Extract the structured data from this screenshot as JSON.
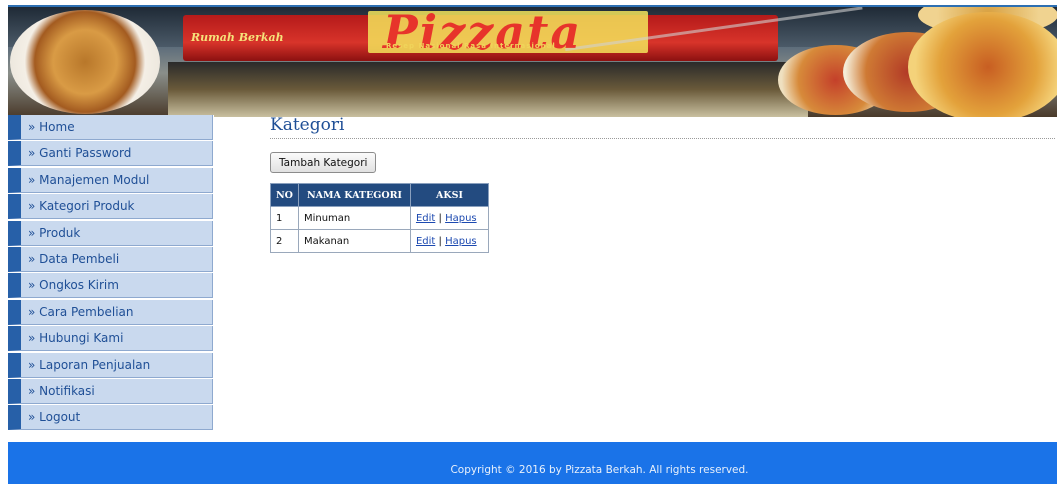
{
  "banner": {
    "tagline_rumah": "Rumah Berkah",
    "brand_name": "Pizzata",
    "brand_subtitle": "Resep Nasional Rasa Internasional"
  },
  "sidebar": {
    "items": [
      {
        "label": "» Home"
      },
      {
        "label": "» Ganti Password"
      },
      {
        "label": "» Manajemen Modul"
      },
      {
        "label": "» Kategori Produk"
      },
      {
        "label": "» Produk"
      },
      {
        "label": "» Data Pembeli"
      },
      {
        "label": "» Ongkos Kirim"
      },
      {
        "label": "» Cara Pembelian"
      },
      {
        "label": "» Hubungi Kami"
      },
      {
        "label": "» Laporan Penjualan"
      },
      {
        "label": "» Notifikasi"
      },
      {
        "label": "» Logout"
      }
    ]
  },
  "main": {
    "title": "Kategori",
    "add_button_label": "Tambah Kategori",
    "table": {
      "headers": [
        "NO",
        "NAMA KATEGORI",
        "AKSI"
      ],
      "rows": [
        {
          "no": "1",
          "name": "Minuman",
          "edit": "Edit",
          "sep": "|",
          "delete": "Hapus"
        },
        {
          "no": "2",
          "name": "Makanan",
          "edit": "Edit",
          "sep": "|",
          "delete": "Hapus"
        }
      ]
    }
  },
  "footer": {
    "copyright": "Copyright © 2016 by Pizzata Berkah. All rights reserved."
  },
  "colors": {
    "nav_bg": "#c9d9ee",
    "nav_accent": "#2760a8",
    "header_blue": "#234b80",
    "footer_blue": "#1a73e8"
  }
}
